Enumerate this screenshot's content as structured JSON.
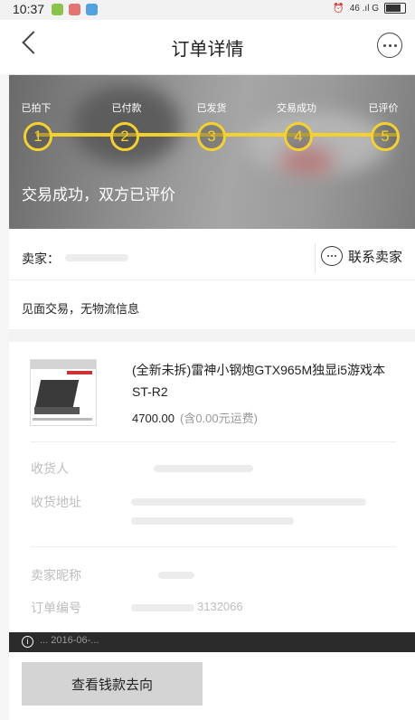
{
  "status_bar": {
    "time": "10:37",
    "signal_text": "46 .ıl G"
  },
  "header": {
    "title": "订单详情"
  },
  "progress": {
    "steps": [
      {
        "label": "已拍下",
        "number": "1"
      },
      {
        "label": "已付款",
        "number": "2"
      },
      {
        "label": "已发货",
        "number": "3"
      },
      {
        "label": "交易成功",
        "number": "4"
      },
      {
        "label": "已评价",
        "number": "5"
      }
    ],
    "status_text": "交易成功，双方已评价"
  },
  "seller": {
    "label": "卖家：",
    "contact_label": "联系卖家",
    "delivery_info": "见面交易，无物流信息"
  },
  "product": {
    "title": "(全新未拆)雷神小钢炮GTX965M独显i5游戏本ST-R2",
    "price": "4700.00",
    "shipping": "(含0.00元运费)"
  },
  "details": {
    "receiver_label": "收货人",
    "address_label": "收货地址",
    "seller_nick_label": "卖家昵称",
    "order_no_label": "订单编号",
    "order_no_value": "3132066"
  },
  "toast": {
    "text": "... 2016-06-..."
  },
  "actions": {
    "view_money_flow": "查看钱款去向"
  },
  "colors": {
    "accent": "#f5d12c",
    "banner": "#8d8d8d"
  }
}
